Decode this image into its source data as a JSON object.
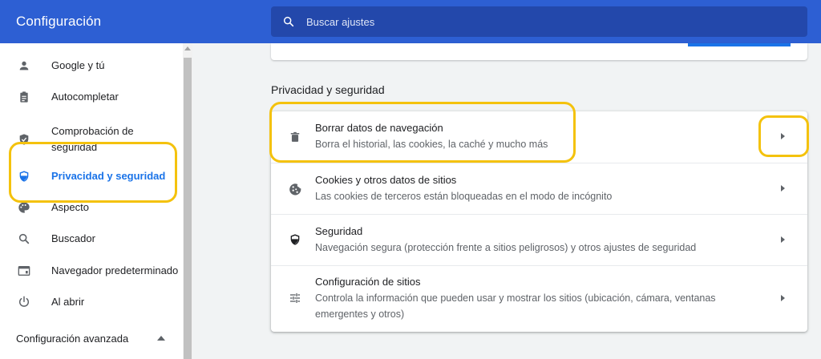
{
  "header": {
    "title": "Configuración",
    "search_placeholder": "Buscar ajustes"
  },
  "sidebar": {
    "items": [
      {
        "label": "Google y tú",
        "icon": "person-icon"
      },
      {
        "label": "Autocompletar",
        "icon": "clipboard-icon"
      },
      {
        "label": "Comprobación de seguridad",
        "icon": "shield-check-icon"
      },
      {
        "label": "Privacidad y seguridad",
        "icon": "shield-privacy-icon",
        "active": true
      },
      {
        "label": "Aspecto",
        "icon": "palette-icon"
      },
      {
        "label": "Buscador",
        "icon": "search-icon"
      },
      {
        "label": "Navegador predeterminado",
        "icon": "browser-icon"
      },
      {
        "label": "Al abrir",
        "icon": "power-icon"
      }
    ],
    "advanced_label": "Configuración avanzada"
  },
  "main": {
    "section_title": "Privacidad y seguridad",
    "rows": [
      {
        "title": "Borrar datos de navegación",
        "desc": "Borra el historial, las cookies, la caché y mucho más",
        "icon": "trash-icon"
      },
      {
        "title": "Cookies y otros datos de sitios",
        "desc": "Las cookies de terceros están bloqueadas en el modo de incógnito",
        "icon": "cookie-icon"
      },
      {
        "title": "Seguridad",
        "desc": "Navegación segura (protección frente a sitios peligrosos) y otros ajustes de seguridad",
        "icon": "shield-icon"
      },
      {
        "title": "Configuración de sitios",
        "desc": "Controla la información que pueden usar y mostrar los sitios (ubicación, cámara, ventanas emergentes y otros)",
        "icon": "sliders-icon"
      }
    ]
  },
  "colors": {
    "header_blue": "#2d5fd3",
    "accent": "#1a73e8",
    "highlight": "#f4c20d"
  }
}
